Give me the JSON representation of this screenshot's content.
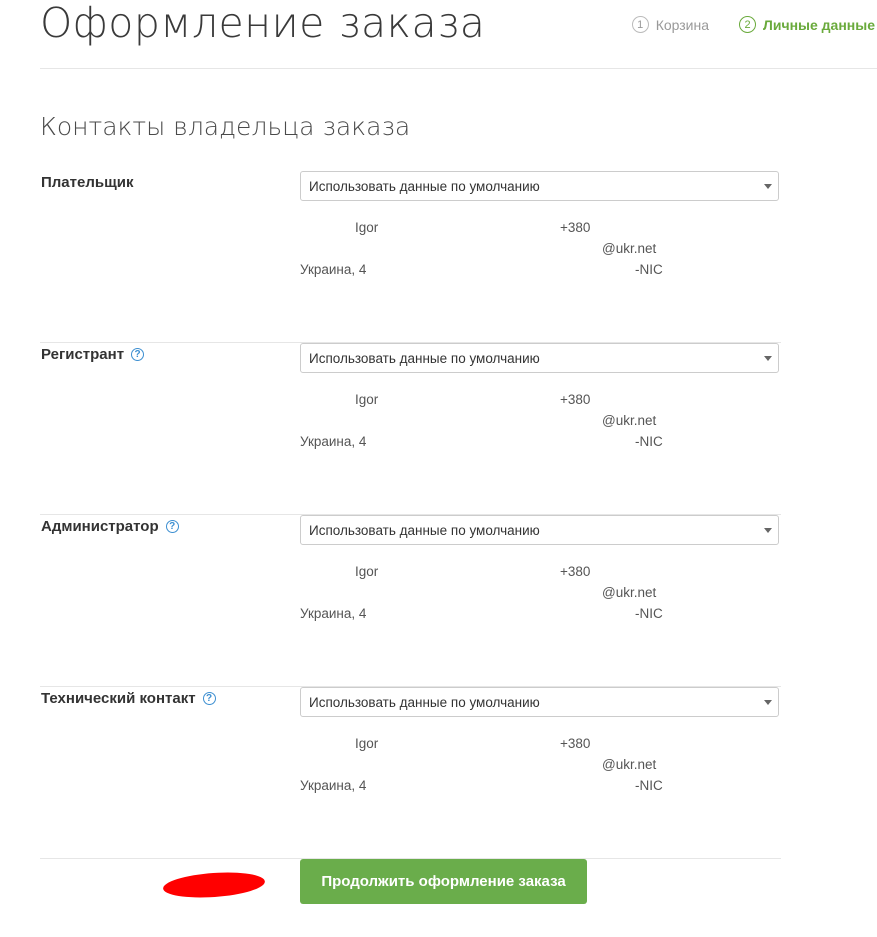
{
  "page": {
    "title": "Оформление заказа",
    "steps": [
      {
        "num": "1",
        "label": "Корзина"
      },
      {
        "num": "2",
        "label": "Личные данные"
      }
    ]
  },
  "section": {
    "title": "Контакты владельца заказа"
  },
  "contacts": [
    {
      "label": "Плательщик",
      "select_value": "Использовать данные по умолчанию",
      "name": "Igor",
      "phone": "+380",
      "email": "@ukr.net",
      "address": "Украина, 4",
      "handle": "-NIC"
    },
    {
      "label": "Регистрант",
      "select_value": "Использовать данные по умолчанию",
      "name": "Igor",
      "phone": "+380",
      "email": "@ukr.net",
      "address": "Украина, 4",
      "handle": "-NIC"
    },
    {
      "label": "Администратор",
      "select_value": "Использовать данные по умолчанию",
      "name": "Igor",
      "phone": "+380",
      "email": "@ukr.net",
      "address": "Украина, 4",
      "handle": "-NIC"
    },
    {
      "label": "Технический контакт",
      "select_value": "Использовать данные по умолчанию",
      "name": "Igor",
      "phone": "+380",
      "email": "@ukr.net",
      "address": "Украина, 4",
      "handle": "-NIC"
    }
  ],
  "help_icon_glyph": "?",
  "actions": {
    "continue_label": "Продолжить оформление заказа"
  },
  "colors": {
    "accent_green": "#6aad4b",
    "help_blue": "#3d8fd1",
    "redaction": "#ff0000"
  }
}
